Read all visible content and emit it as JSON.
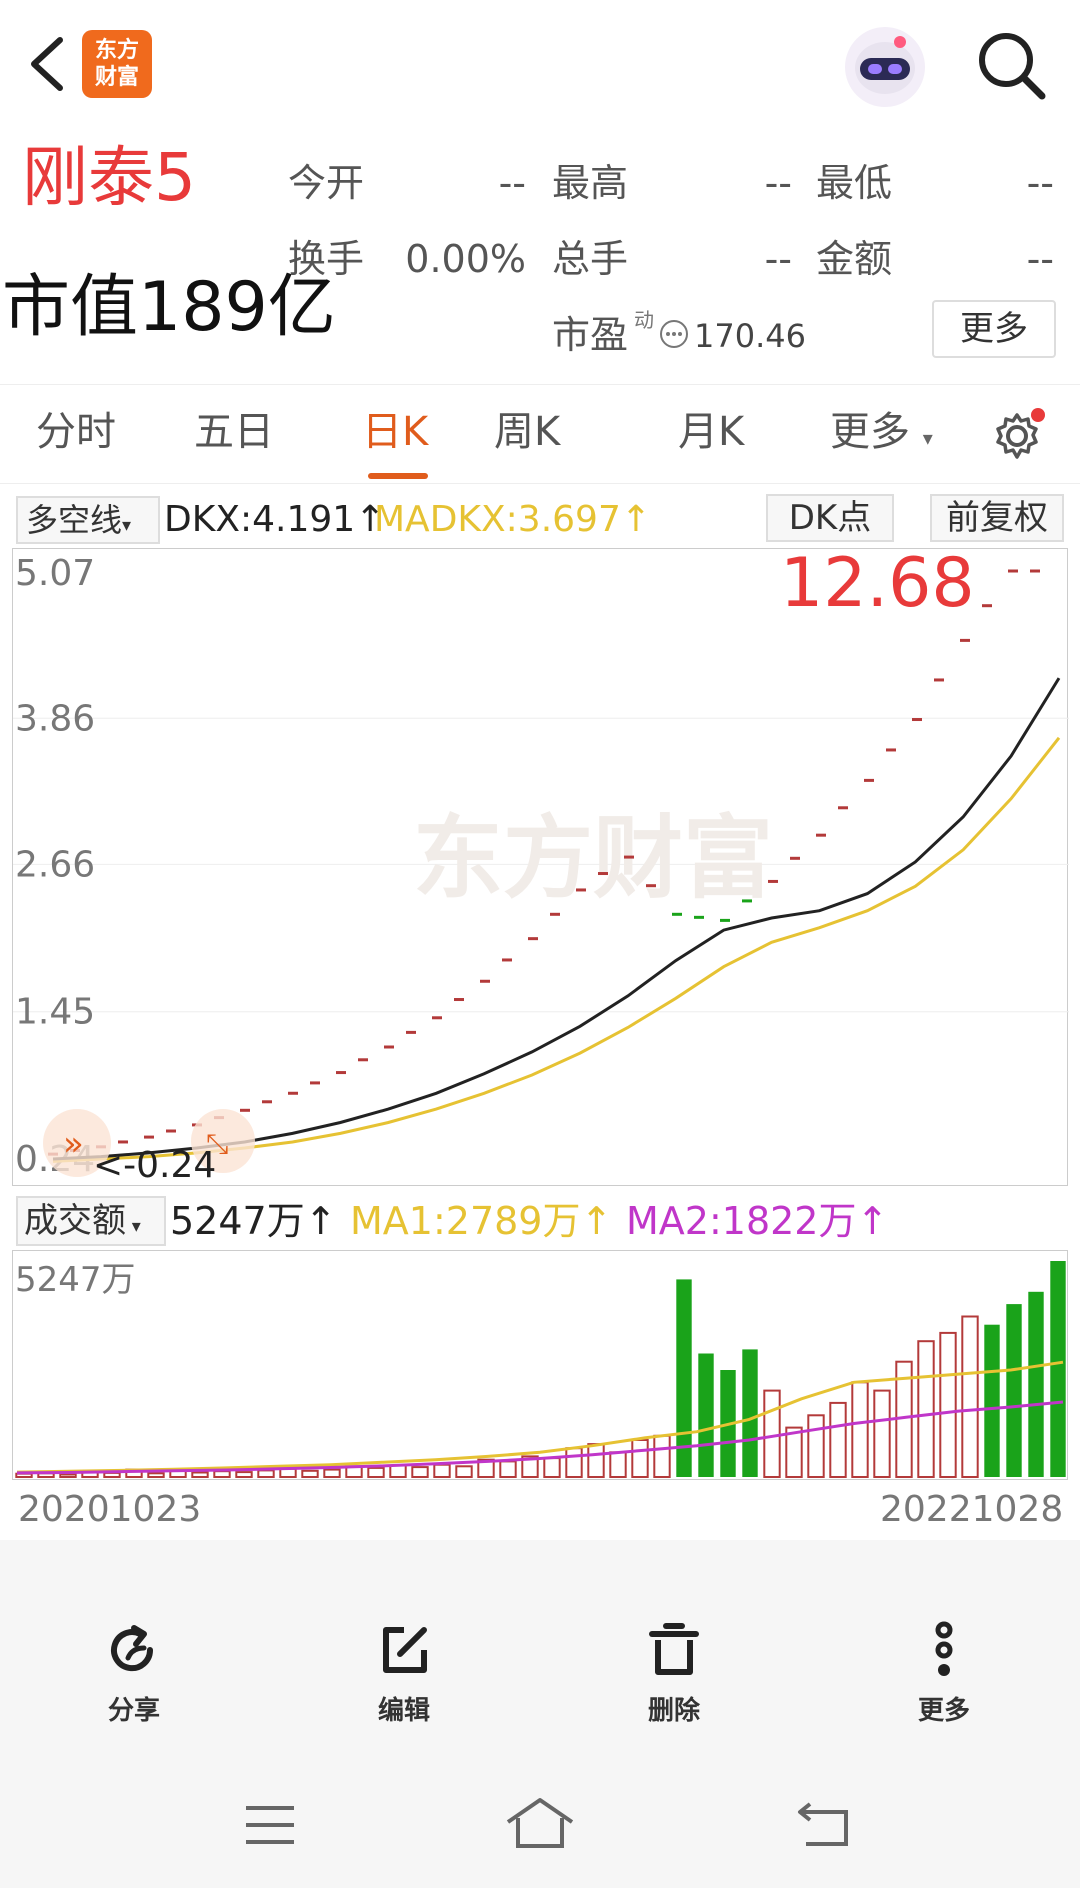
{
  "header": {
    "logo_line1": "东方",
    "logo_line2": "财富"
  },
  "stock": {
    "name": "刚泰5",
    "market_cap": "市值189亿"
  },
  "quote": {
    "open_label": "今开",
    "open_value": "--",
    "high_label": "最高",
    "high_value": "--",
    "low_label": "最低",
    "low_value": "--",
    "turnover_label": "换手",
    "turnover_value": "0.00%",
    "volume_label": "总手",
    "volume_value": "--",
    "amount_label": "金额",
    "amount_value": "--",
    "pe_label": "市盈",
    "pe_sup": "动",
    "pe_value": "170.46",
    "more_label": "更多"
  },
  "tabs": {
    "items": [
      "分时",
      "五日",
      "日K",
      "周K",
      "月K",
      "更多"
    ],
    "active": "日K"
  },
  "indicator": {
    "selector": "多空线",
    "dkx": "DKX:4.191↑",
    "madkx": "MADKX:3.697↑",
    "dk_points": "DK点",
    "adjust": "前复权",
    "price_callout": "12.68",
    "low_callout": "<-0.24"
  },
  "volume": {
    "selector": "成交额",
    "value": "5247万↑",
    "ma1": "MA1:2789万↑",
    "ma2": "MA2:1822万↑",
    "axis_top": "5247万"
  },
  "dates": {
    "start": "20201023",
    "end": "20221028"
  },
  "actions": {
    "share": "分享",
    "edit": "编辑",
    "delete": "删除",
    "more": "更多"
  },
  "colors": {
    "up": "#b33a3a",
    "down": "#1aa31a",
    "dkx": "#222222",
    "madkx": "#e6c233",
    "ma2": "#c036c9",
    "accent": "#e05c1c"
  },
  "chart_data": [
    {
      "type": "line",
      "title": "",
      "y_ticks": [
        5.07,
        3.86,
        2.66,
        1.45,
        0.24
      ],
      "ylim": [
        0.24,
        5.07
      ],
      "series": [
        {
          "name": "DKX",
          "values": [
            0.24,
            0.26,
            0.29,
            0.33,
            0.38,
            0.45,
            0.54,
            0.65,
            0.78,
            0.94,
            1.12,
            1.33,
            1.58,
            1.87,
            2.12,
            2.22,
            2.28,
            2.42,
            2.68,
            3.05,
            3.55,
            4.19
          ]
        },
        {
          "name": "MADKX",
          "values": [
            0.22,
            0.24,
            0.26,
            0.29,
            0.33,
            0.38,
            0.45,
            0.54,
            0.65,
            0.78,
            0.93,
            1.11,
            1.32,
            1.56,
            1.82,
            2.02,
            2.14,
            2.28,
            2.48,
            2.78,
            3.2,
            3.7
          ]
        }
      ],
      "dk_points": [
        0.28,
        0.34,
        0.42,
        0.52,
        0.64,
        0.78,
        0.95,
        1.16,
        1.4,
        1.7,
        2.05,
        2.45,
        2.72,
        2.25,
        2.2,
        2.52,
        2.9,
        3.35,
        3.85,
        4.5,
        5.07
      ]
    },
    {
      "type": "bar",
      "title": "",
      "ylim": [
        0,
        5247
      ],
      "values": [
        80,
        90,
        60,
        120,
        100,
        180,
        90,
        150,
        110,
        140,
        120,
        160,
        200,
        150,
        180,
        260,
        220,
        280,
        240,
        300,
        260,
        420,
        380,
        500,
        460,
        700,
        800,
        600,
        900,
        1000,
        4800,
        3000,
        2600,
        3100,
        2100,
        1200,
        1500,
        1800,
        2300,
        2100,
        2800,
        3300,
        3500,
        3900,
        3700,
        4200,
        4500,
        5247
      ],
      "down_indices": [
        30,
        31,
        32,
        33,
        44,
        45,
        46,
        47
      ],
      "ma1": [
        120,
        140,
        160,
        190,
        220,
        260,
        300,
        360,
        420,
        500,
        600,
        760,
        950,
        1100,
        1400,
        1900,
        2300,
        2400,
        2500,
        2600,
        2789
      ],
      "ma2": [
        100,
        110,
        130,
        150,
        170,
        200,
        230,
        270,
        320,
        380,
        450,
        540,
        650,
        760,
        900,
        1100,
        1300,
        1450,
        1600,
        1700,
        1822
      ]
    }
  ]
}
